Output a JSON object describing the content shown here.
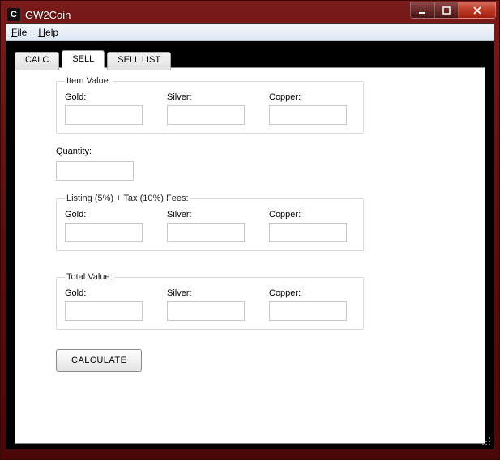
{
  "window": {
    "title": "GW2Coin",
    "icon_letter": "C"
  },
  "menubar": {
    "file": "File",
    "help": "Help"
  },
  "tabs": [
    {
      "label": "CALC",
      "active": false
    },
    {
      "label": "SELL",
      "active": true
    },
    {
      "label": "SELL LIST",
      "active": false
    }
  ],
  "sell": {
    "item_value": {
      "title": "Item Value:",
      "gold_label": "Gold:",
      "silver_label": "Silver:",
      "copper_label": "Copper:",
      "gold_value": "",
      "silver_value": "",
      "copper_value": ""
    },
    "quantity": {
      "label": "Quantity:",
      "value": ""
    },
    "fees": {
      "title": "Listing (5%) + Tax (10%) Fees:",
      "gold_label": "Gold:",
      "silver_label": "Silver:",
      "copper_label": "Copper:",
      "gold_value": "",
      "silver_value": "",
      "copper_value": ""
    },
    "total": {
      "title": "Total Value:",
      "gold_label": "Gold:",
      "silver_label": "Silver:",
      "copper_label": "Copper:",
      "gold_value": "",
      "silver_value": "",
      "copper_value": ""
    },
    "calculate_label": "CALCULATE"
  }
}
